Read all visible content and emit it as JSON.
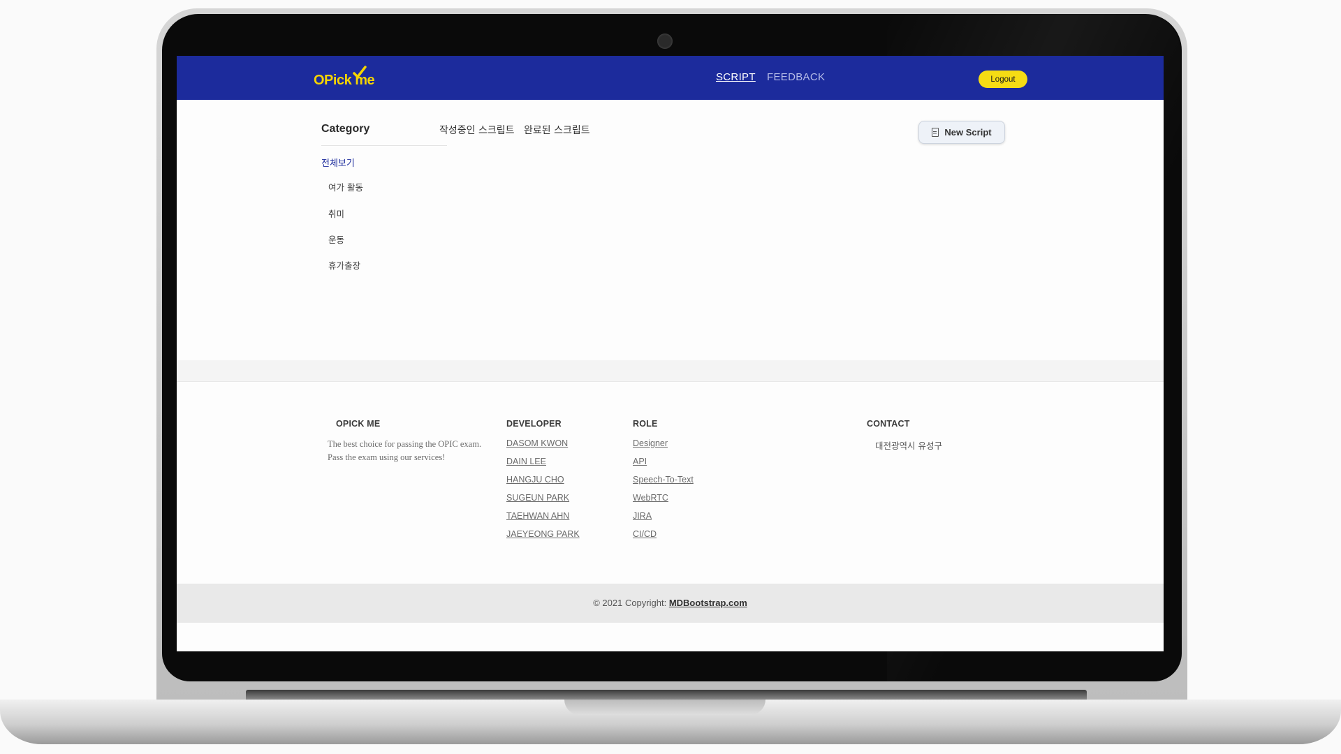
{
  "navbar": {
    "logo_text_left": "OPick",
    "logo_text_right": "me",
    "links": [
      {
        "label": "SCRIPT",
        "active": true
      },
      {
        "label": "FEEDBACK",
        "active": false
      }
    ],
    "logout_label": "Logout"
  },
  "sidebar": {
    "title": "Category",
    "all_label": "전체보기",
    "items": [
      "여가 활동",
      "취미",
      "운동",
      "휴가출장"
    ]
  },
  "tabs": [
    "작성중인 스크립트",
    "완료된 스크립트"
  ],
  "new_script_label": "New Script",
  "footer": {
    "about_title": "OPICK ME",
    "about_text": "The best choice for passing the OPIC exam. Pass the exam using our services!",
    "developer_title": "DEVELOPER",
    "developers": [
      "DASOM KWON",
      "DAIN LEE",
      "HANGJU CHO",
      "SUGEUN PARK",
      "TAEHWAN AHN",
      "JAEYEONG PARK"
    ],
    "role_title": "ROLE",
    "roles": [
      "Designer",
      "API",
      "Speech-To-Text",
      "WebRTC",
      "JIRA",
      "CI/CD"
    ],
    "contact_title": "CONTACT",
    "contact_text": "대전광역시 유성구"
  },
  "copyright": {
    "text": "© 2021 Copyright:",
    "link": "MDBootstrap.com"
  },
  "colors": {
    "navbar": "#1c2b9c",
    "logo": "#f5d400",
    "logout_button": "#f5dc14",
    "active_category": "#1c2b9c"
  },
  "icons": [
    "checkmark-icon",
    "document-icon",
    "camera-dot"
  ]
}
